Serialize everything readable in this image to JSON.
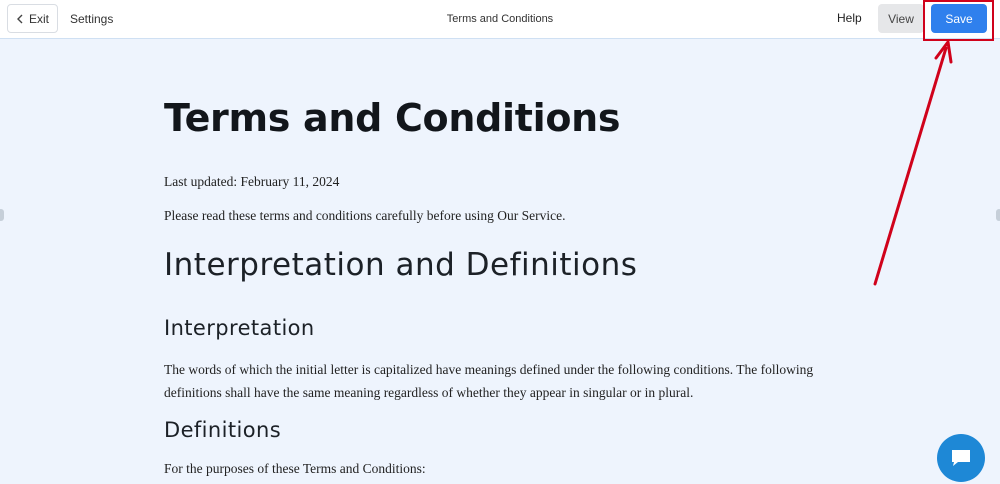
{
  "topbar": {
    "exit_label": "Exit",
    "settings_label": "Settings",
    "title": "Terms and Conditions",
    "help_label": "Help",
    "view_label": "View",
    "save_label": "Save"
  },
  "document": {
    "title": "Terms and Conditions",
    "last_updated": "Last updated: February 11, 2024",
    "intro": "Please read these terms and conditions carefully before using Our Service.",
    "section_heading": "Interpretation and Definitions",
    "interpretation_heading": "Interpretation",
    "interpretation_text": "The words of which the initial letter is capitalized have meanings defined under the following conditions. The following definitions shall have the same meaning regardless of whether they appear in singular or in plural.",
    "definitions_heading": "Definitions",
    "definitions_text": "For the purposes of these Terms and Conditions:"
  },
  "colors": {
    "accent": "#2f80ed",
    "annotation": "#d0021b",
    "chat": "#1e88d6",
    "canvas": "#eef4fd"
  },
  "icons": {
    "exit": "chevron-left-icon",
    "chat": "chat-bubble-icon"
  }
}
